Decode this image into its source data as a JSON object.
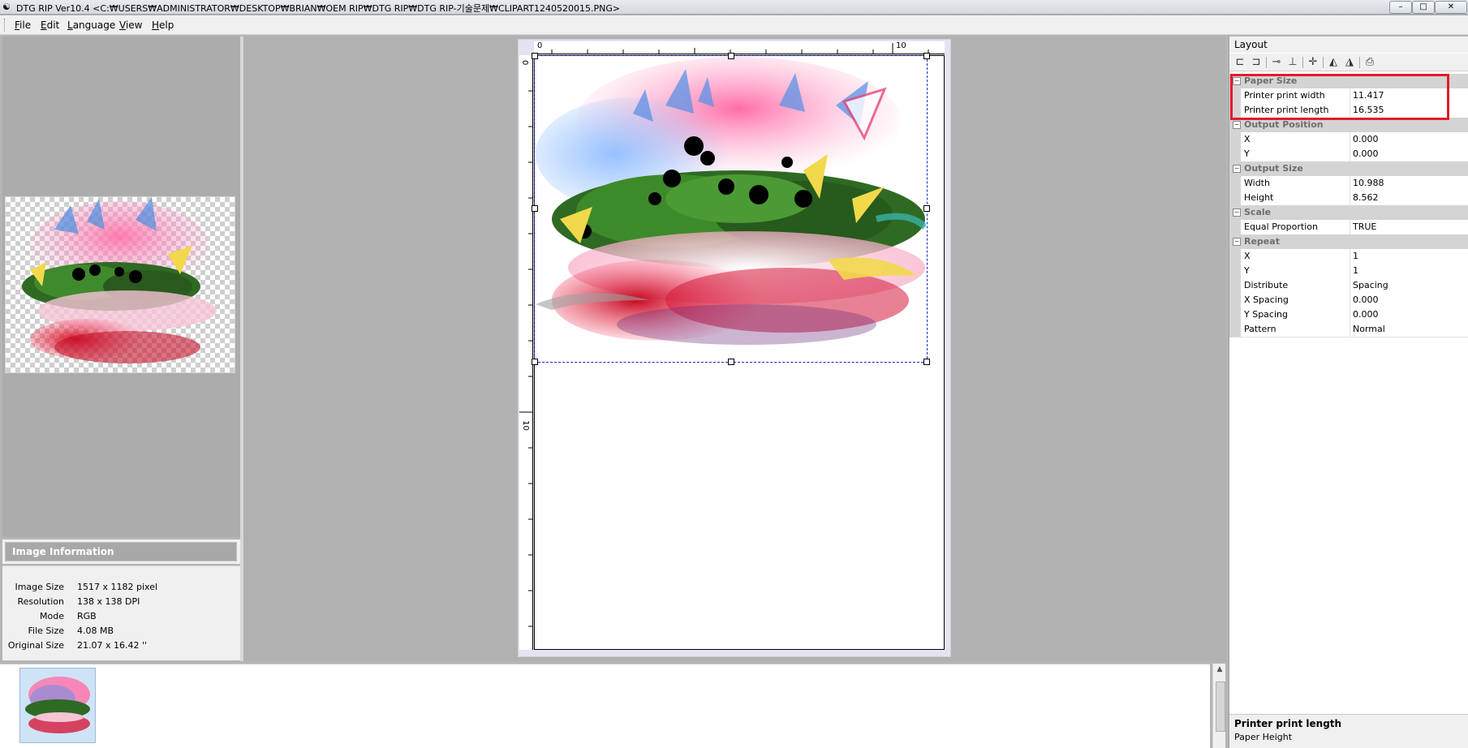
{
  "window": {
    "app_icon": "app-icon",
    "title": "DTG RIP Ver10.4 <C:₩USERS₩ADMINISTRATOR₩DESKTOP₩BRIAN₩OEM RIP₩DTG RIP₩DTG RIP-기술문제₩CLIPART1240520015.PNG>",
    "controls": {
      "minimize": "–",
      "maximize": "□",
      "close": "✕"
    }
  },
  "menu": {
    "items": [
      {
        "key": "F",
        "rest": "ile"
      },
      {
        "key": "E",
        "rest": "dit"
      },
      {
        "key": "L",
        "rest": "anguage"
      },
      {
        "key": "V",
        "rest": "iew"
      },
      {
        "key": "H",
        "rest": "elp"
      }
    ]
  },
  "image_info": {
    "header": "Image Information",
    "rows": [
      {
        "label": "Image Size",
        "value": "1517 x 1182 pixel"
      },
      {
        "label": "Resolution",
        "value": "138 x 138 DPI"
      },
      {
        "label": "Mode",
        "value": "RGB"
      },
      {
        "label": "File Size",
        "value": "4.08 MB"
      },
      {
        "label": "Original Size",
        "value": "21.07 x 16.42 ''"
      }
    ]
  },
  "ruler": {
    "h_zero": "0",
    "h_ten": "10",
    "v_zero": "0",
    "v_ten": "10"
  },
  "layout_panel": {
    "title": "Layout",
    "toolbar_icons": [
      "align-left-top-icon",
      "align-right-top-icon",
      "center-horizontal-icon",
      "center-vertical-icon",
      "center-both-icon",
      "flip-horizontal-icon",
      "mirror-icon",
      "print-icon"
    ],
    "categories": [
      {
        "name": "Paper Size",
        "rows": [
          {
            "k": "Printer print width",
            "v": "11.417"
          },
          {
            "k": "Printer print length",
            "v": "16.535"
          }
        ]
      },
      {
        "name": "Output Position",
        "rows": [
          {
            "k": "X",
            "v": "0.000"
          },
          {
            "k": "Y",
            "v": "0.000"
          }
        ]
      },
      {
        "name": "Output Size",
        "rows": [
          {
            "k": "Width",
            "v": "10.988"
          },
          {
            "k": "Height",
            "v": "8.562"
          }
        ]
      },
      {
        "name": "Scale",
        "rows": [
          {
            "k": "Equal Proportion",
            "v": "TRUE"
          }
        ]
      },
      {
        "name": "Repeat",
        "rows": [
          {
            "k": "X",
            "v": "1"
          },
          {
            "k": "Y",
            "v": "1"
          },
          {
            "k": "Distribute",
            "v": "Spacing"
          },
          {
            "k": "X Spacing",
            "v": "0.000"
          },
          {
            "k": "Y Spacing",
            "v": "0.000"
          },
          {
            "k": "Pattern",
            "v": "Normal"
          }
        ]
      }
    ],
    "help": {
      "title": "Printer print length",
      "desc": "Paper Height"
    }
  },
  "colors": {
    "highlight": "#e11c2a",
    "selection": "#1726c8",
    "category_bg": "#d4d4d4"
  }
}
